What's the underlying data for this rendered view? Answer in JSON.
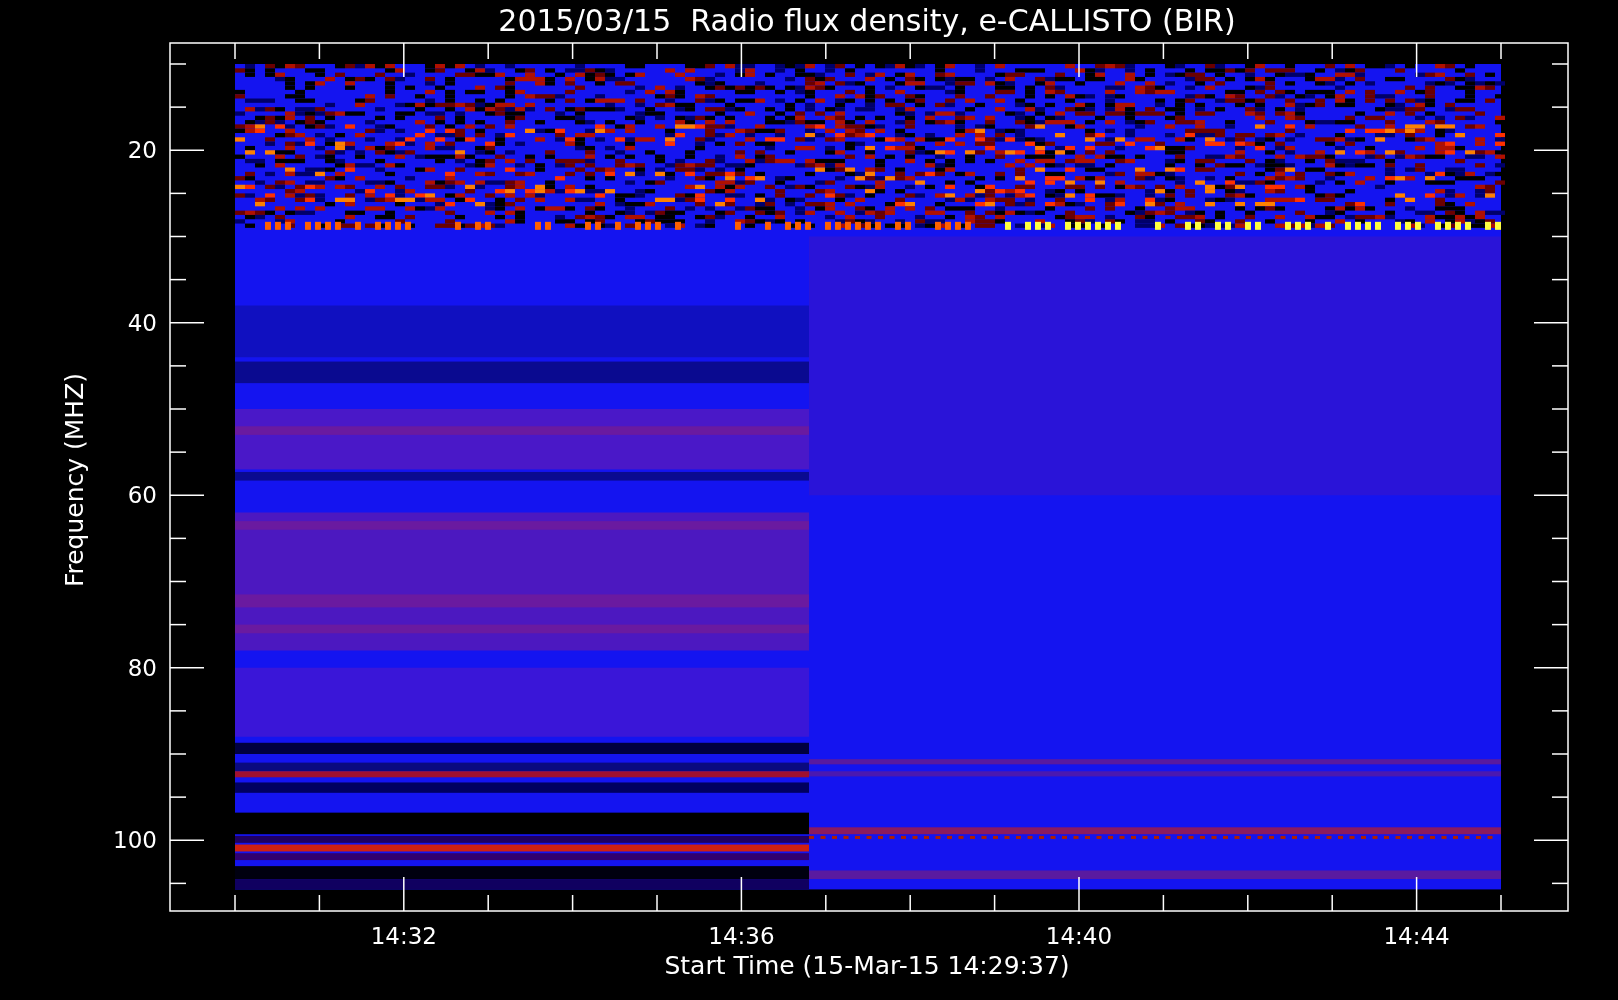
{
  "title": "2015/03/15  Radio flux density, e-CALLISTO (BIR)",
  "y_axis": {
    "label": "Frequency (MHZ)",
    "ticks": [
      "20",
      "40",
      "60",
      "80",
      "100"
    ]
  },
  "x_axis": {
    "label": "Start Time (15-Mar-15 14:29:37)",
    "ticks": [
      "14:32",
      "14:36",
      "14:40",
      "14:44"
    ]
  },
  "plot": {
    "kind": "spectrogram"
  }
}
